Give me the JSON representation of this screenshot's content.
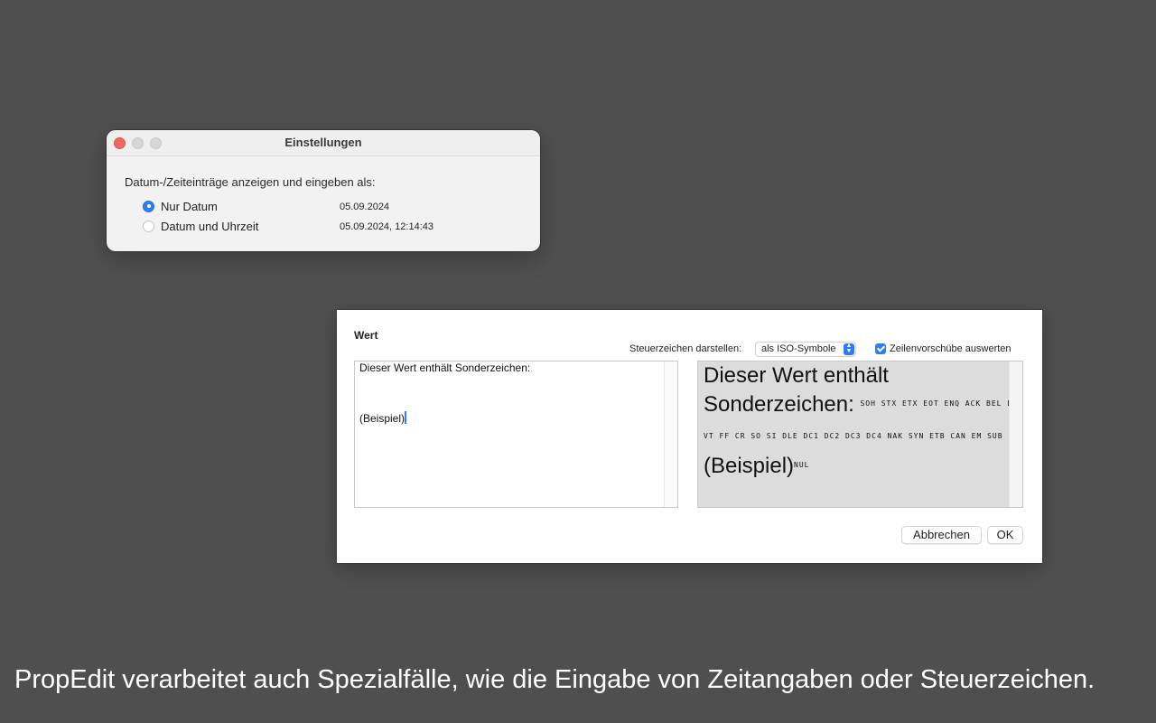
{
  "settings_window": {
    "title": "Einstellungen",
    "prompt": "Datum-/Zeiteinträge anzeigen und eingeben als:",
    "options": [
      {
        "label": "Nur Datum",
        "example": "05.09.2024",
        "selected": true
      },
      {
        "label": "Datum und Uhrzeit",
        "example": "05.09.2024, 12:14:43",
        "selected": false
      }
    ]
  },
  "value_dialog": {
    "heading": "Wert",
    "control_chars_label": "Steuerzeichen darstellen:",
    "control_chars_select": "als ISO-Symbole",
    "line_feeds_checkbox": {
      "label": "Zeilenvorschübe auswerten",
      "checked": true
    },
    "editor": {
      "line1": "Dieser Wert enthält Sonderzeichen:",
      "line2": "(Beispiel)"
    },
    "preview": {
      "line1": "Dieser Wert enthält",
      "line2": "Sonderzeichen:",
      "iso_symbols_1": "SOH STX ETX EOT ENQ ACK BEL BS HT",
      "iso_symbols_2": "VT FF CR SO SI DLE DC1 DC2 DC3 DC4 NAK SYN ETB CAN EM SUB ESC FS GS RS US",
      "line3": "(Beispiel)",
      "iso_symbols_3": "NUL"
    },
    "buttons": {
      "cancel": "Abbrechen",
      "ok": "OK"
    }
  },
  "caption": "PropEdit verarbeitet auch Spezialfälle, wie die Eingabe von Zeitangaben oder Steuerzeichen.",
  "colors": {
    "background": "#4f4f4f",
    "accent": "#2e7cf6",
    "close": "#ed6a5e"
  }
}
